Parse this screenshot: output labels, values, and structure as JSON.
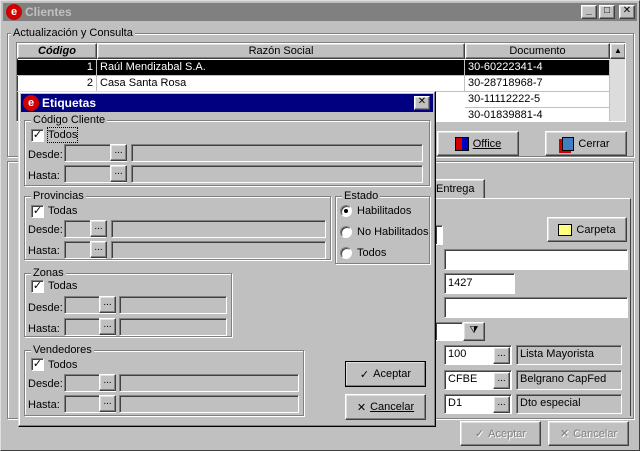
{
  "main_window": {
    "title": "Clientes",
    "update_group_label": "Actualización y Consulta",
    "table": {
      "columns": [
        "Código",
        "Razón Social",
        "Documento"
      ],
      "rows": [
        {
          "codigo": "1",
          "razon": "Raúl Mendizabal S.A.",
          "doc": "30-60222341-4"
        },
        {
          "codigo": "2",
          "razon": "Casa Santa Rosa",
          "doc": "30-28718968-7"
        },
        {
          "codigo": "",
          "razon": "",
          "doc": "30-11112222-5"
        },
        {
          "codigo": "",
          "razon": "",
          "doc": "30-01839881-4"
        }
      ]
    },
    "office_label": "Office",
    "close_label": "Cerrar",
    "tab_label": "Entrega",
    "carpeta_label": "Carpeta",
    "field_zip": "1427",
    "lookup_rows": [
      {
        "code": "100",
        "desc": "Lista Mayorista"
      },
      {
        "code": "CFBE",
        "desc": "Belgrano CapFed"
      },
      {
        "code": "D1",
        "desc": "Dto especial"
      }
    ],
    "aceptar_label": "Aceptar",
    "cancelar_label": "Cancelar"
  },
  "dialog": {
    "title": "Etiquetas",
    "codigo_cliente": {
      "label": "Código Cliente",
      "todos": "Todos",
      "desde": "Desde:",
      "hasta": "Hasta:"
    },
    "provincias": {
      "label": "Provincias",
      "todas": "Todas",
      "desde": "Desde:",
      "hasta": "Hasta:"
    },
    "estado": {
      "label": "Estado",
      "options": [
        "Habilitados",
        "No Habilitados",
        "Todos"
      ],
      "selected": "Habilitados"
    },
    "zonas": {
      "label": "Zonas",
      "todas": "Todas",
      "desde": "Desde:",
      "hasta": "Hasta:"
    },
    "vendedores": {
      "label": "Vendedores",
      "todos": "Todos",
      "desde": "Desde:",
      "hasta": "Hasta:"
    },
    "aceptar_label": "Aceptar",
    "cancelar_label": "Cancelar",
    "ellipsis": "..."
  },
  "colors": {
    "title_active": "#000080",
    "title_inactive": "#808080"
  }
}
